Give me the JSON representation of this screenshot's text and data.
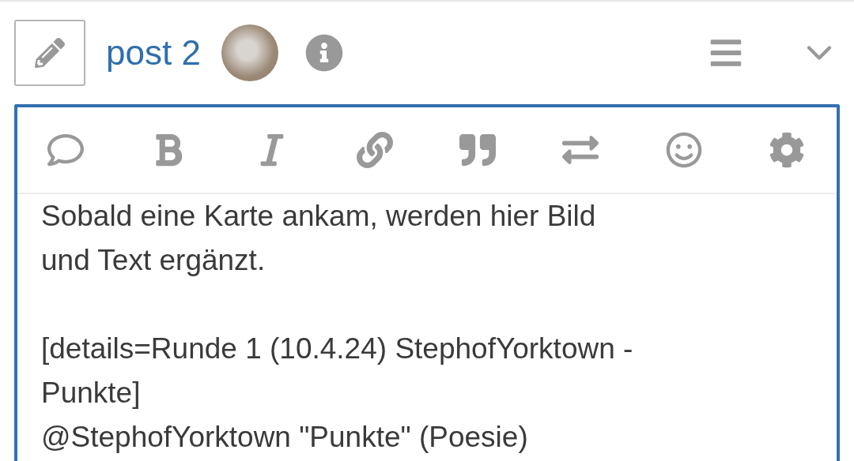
{
  "header": {
    "title": "post 2"
  },
  "editor": {
    "value": "Sobald eine Karte ankam, werden hier Bild\nund Text ergänzt.\n\n[details=Runde 1 (10.4.24) StephofYorktown -\nPunkte]\n@StephofYorktown \"Punkte\" (Poesie)"
  }
}
